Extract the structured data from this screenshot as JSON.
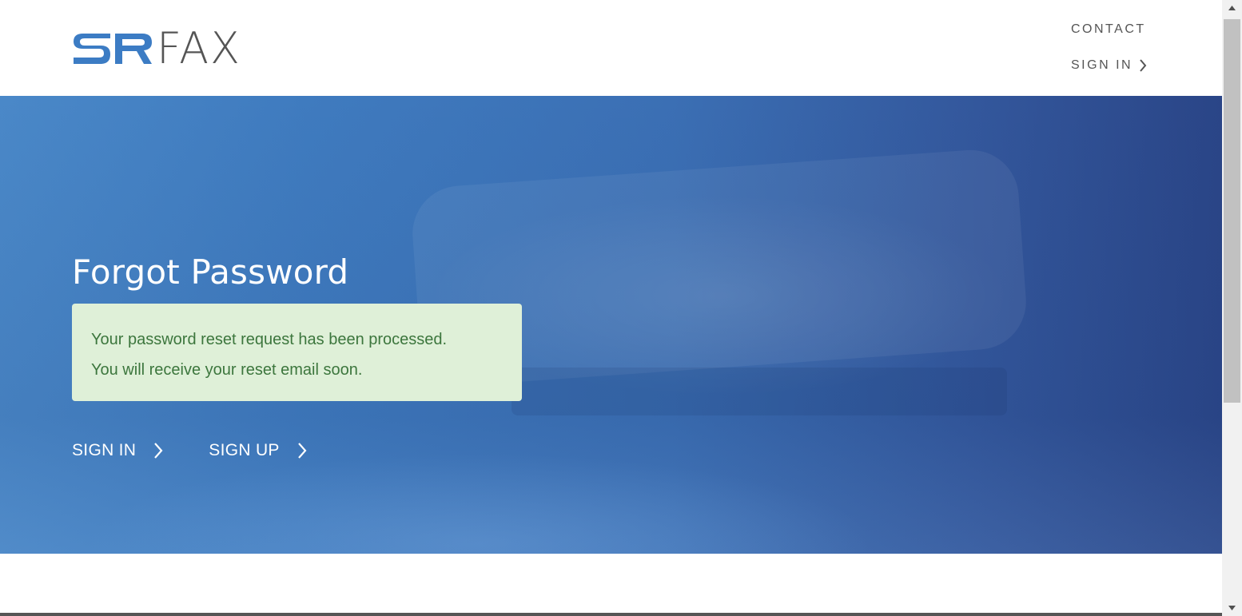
{
  "header": {
    "logo_text": "FAX",
    "logo_mark": "SR",
    "nav": {
      "contact_label": "CONTACT",
      "signin_label": "SIGN IN"
    }
  },
  "hero": {
    "title": "Forgot Password",
    "alert": {
      "line1": "Your password reset request has been processed.",
      "line2": "You will receive your reset email soon."
    },
    "links": {
      "signin_label": "SIGN IN",
      "signup_label": "SIGN UP"
    }
  },
  "icons": {
    "chevron": "chevron-right-icon",
    "scroll_up": "scroll-up-arrow-icon",
    "scroll_down": "scroll-down-arrow-icon"
  },
  "colors": {
    "brand_blue": "#3c7cc4",
    "logo_text_gray": "#555555",
    "alert_bg": "#dff0d8",
    "alert_text": "#3c763d"
  }
}
